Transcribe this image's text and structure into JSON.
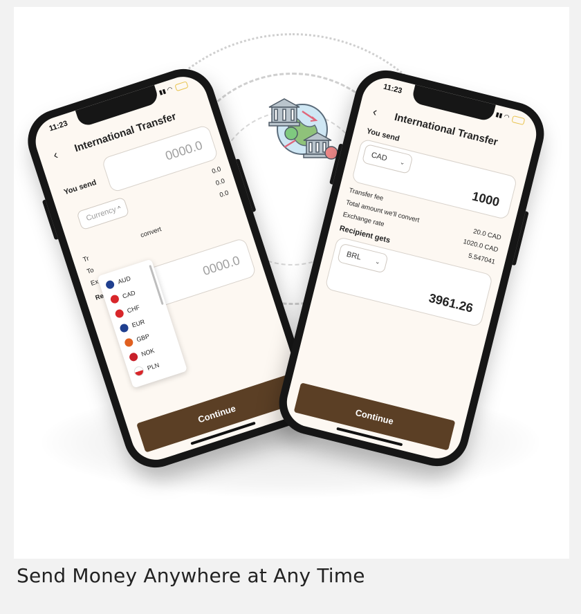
{
  "caption": "Send Money Anywhere at Any Time",
  "phone_left": {
    "status_time": "11:23",
    "title": "International Transfer",
    "you_send_label": "You send",
    "send_amount_placeholder": "0000.0",
    "currency_placeholder": "Currency",
    "fee_value": "0.0",
    "convert_value": "0.0",
    "rate_value": "0.0",
    "partial_labels": {
      "transfer": "Tr",
      "total": "To",
      "exchange": "Ex",
      "convert": "convert",
      "recipient": "Re"
    },
    "recipient_amount_placeholder": "0000.0",
    "currency_options": [
      {
        "code": "AUD",
        "color": "#1f3f8f"
      },
      {
        "code": "CAD",
        "color": "#d8262a"
      },
      {
        "code": "CHF",
        "color": "#d8262a"
      },
      {
        "code": "EUR",
        "color": "#1f3f8f"
      },
      {
        "code": "GBP",
        "color": "#e06020"
      },
      {
        "code": "NOK",
        "color": "#c8202a"
      },
      {
        "code": "PLN",
        "color": "#d8262a"
      }
    ],
    "continue_label": "Continue"
  },
  "phone_right": {
    "status_time": "11:23",
    "title": "International Transfer",
    "you_send_label": "You send",
    "send_currency": "CAD",
    "send_amount": "1000",
    "transfer_fee_label": "Transfer fee",
    "transfer_fee_value": "20.0 CAD",
    "total_convert_label": "Total amount we'll convert",
    "total_convert_value": "1020.0 CAD",
    "exchange_rate_label": "Exchange rate",
    "exchange_rate_value": "5.547041",
    "recipient_label": "Recipient gets",
    "recipient_currency": "BRL",
    "recipient_amount": "3961.26",
    "continue_label": "Continue"
  },
  "colors": {
    "accent": "#5b3f25",
    "screen_bg": "#fdf8f2",
    "frame": "#161616"
  }
}
